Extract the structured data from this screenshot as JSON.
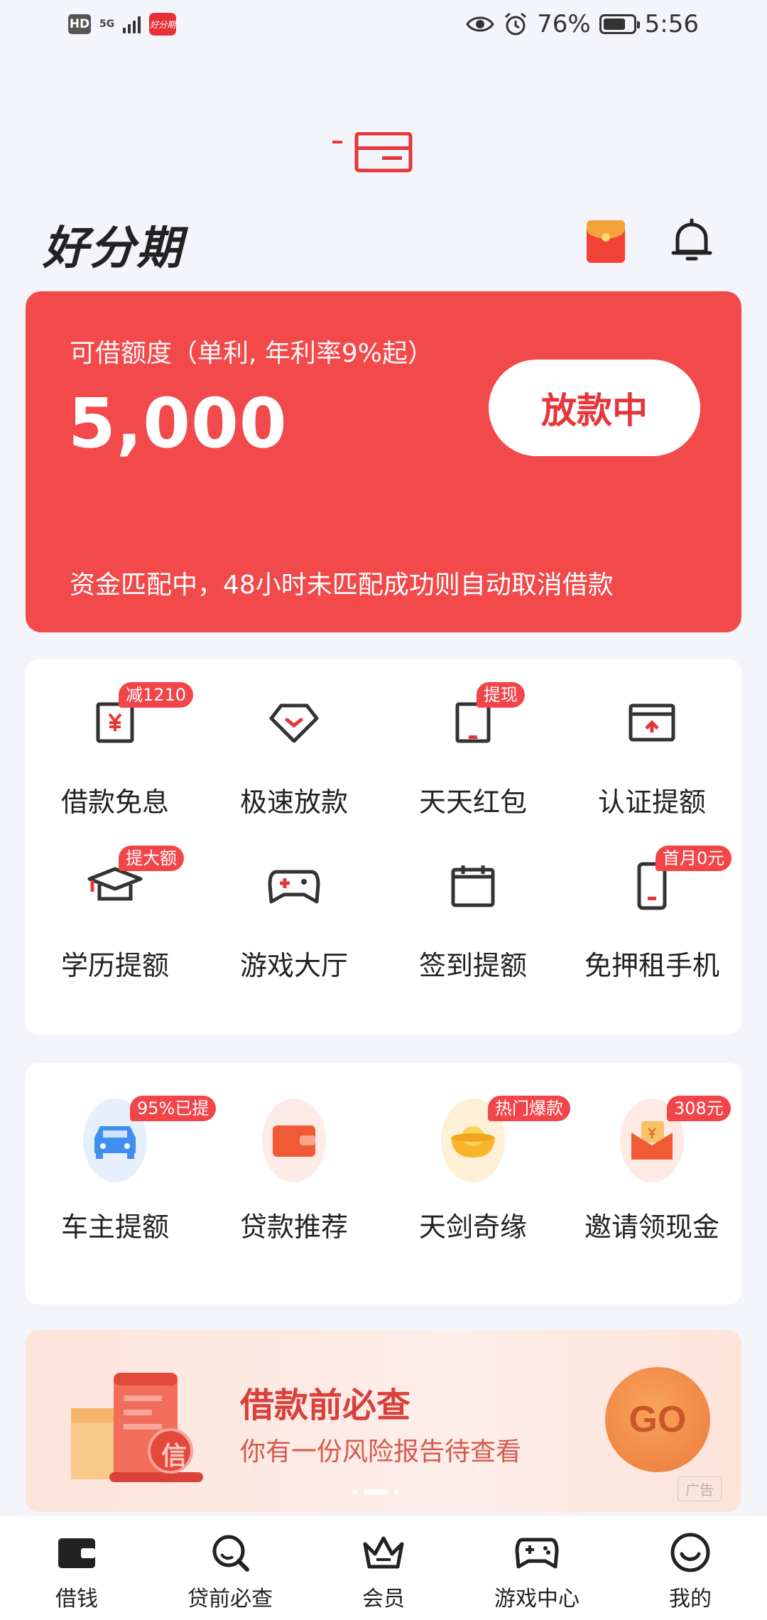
{
  "status_bar": {
    "hd": "HD",
    "network": "5G",
    "app_badge": "好分期",
    "battery": "76%",
    "battery_level": 0.76,
    "time": "5:56"
  },
  "header": {
    "logo": "好分期"
  },
  "quota": {
    "label": "可借额度（单利, 年利率9%起）",
    "amount": "5,000",
    "button": "放款中",
    "note": "资金匹配中，48小时未匹配成功则自动取消借款"
  },
  "grid": [
    {
      "label": "借款免息",
      "badge": "减1210",
      "icon": "interest-free-icon"
    },
    {
      "label": "极速放款",
      "badge": "",
      "icon": "diamond-icon"
    },
    {
      "label": "天天红包",
      "badge": "提现",
      "icon": "red-packet-icon"
    },
    {
      "label": "认证提额",
      "badge": "",
      "icon": "card-upload-icon"
    },
    {
      "label": "学历提额",
      "badge": "提大额",
      "icon": "graduation-cap-icon"
    },
    {
      "label": "游戏大厅",
      "badge": "",
      "icon": "gamepad-icon"
    },
    {
      "label": "签到提额",
      "badge": "",
      "icon": "calendar-icon"
    },
    {
      "label": "免押租手机",
      "badge": "首月0元",
      "icon": "phone-icon"
    }
  ],
  "grid2": [
    {
      "label": "车主提额",
      "badge": "95%已提",
      "icon": "car-icon"
    },
    {
      "label": "贷款推荐",
      "badge": "",
      "icon": "wallet-icon"
    },
    {
      "label": "天剑奇缘",
      "badge": "热门爆款",
      "icon": "gold-ingot-icon"
    },
    {
      "label": "邀请领现金",
      "badge": "308元",
      "icon": "cash-envelope-icon"
    }
  ],
  "banner": {
    "title": "借款前必查",
    "subtitle": "你有一份风险报告待查看",
    "go": "GO",
    "ad": "广告",
    "stamp": "信"
  },
  "tabbar": [
    {
      "label": "借钱",
      "icon": "wallet-icon"
    },
    {
      "label": "贷前必查",
      "icon": "search-icon"
    },
    {
      "label": "会员",
      "icon": "crown-icon"
    },
    {
      "label": "游戏中心",
      "icon": "gamepad-icon"
    },
    {
      "label": "我的",
      "icon": "smile-icon"
    }
  ],
  "colors": {
    "brand_red": "#f2494a",
    "accent_orange": "#ee7a3a",
    "background": "#f4f5fa"
  }
}
